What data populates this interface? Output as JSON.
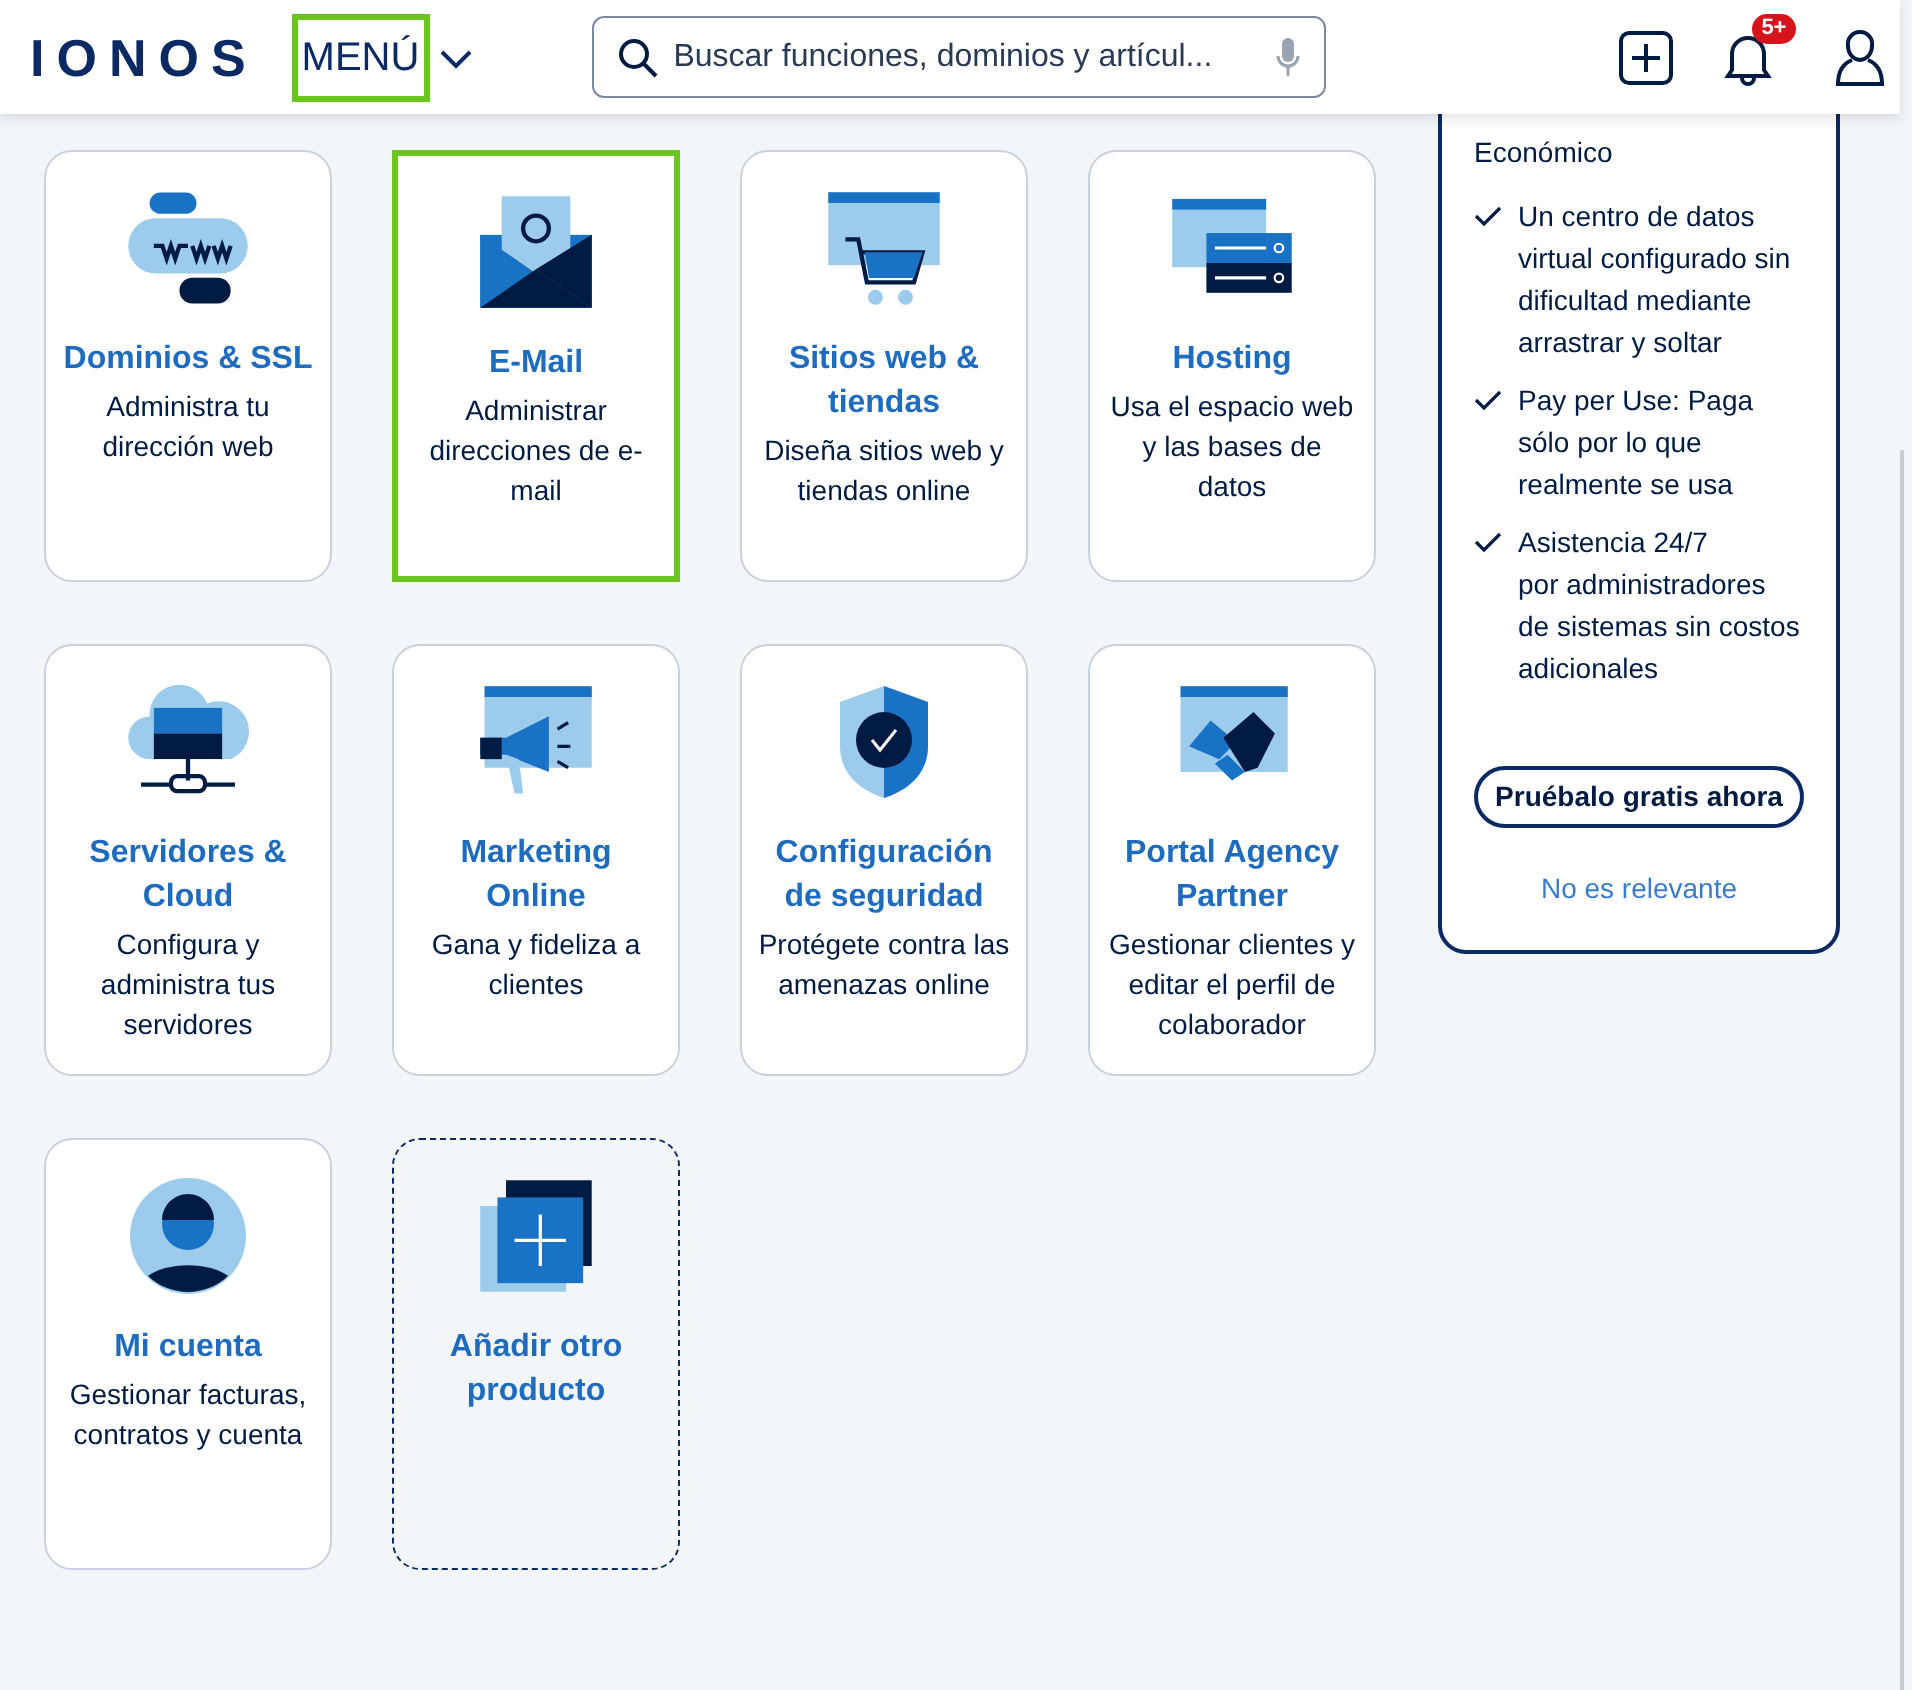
{
  "header": {
    "logo": "IONOS",
    "menu": {
      "label": "MENÚ",
      "highlighted": true
    },
    "search": {
      "placeholder": "Buscar funciones, dominios y artícul..."
    },
    "notifications": {
      "badge": "5+"
    }
  },
  "products": [
    {
      "kind": "product",
      "title": "Dominios & SSL",
      "description": "Administra tu dirección web",
      "highlighted": false
    },
    {
      "kind": "product",
      "title": "E-Mail",
      "description": "Administrar direcciones de e-mail",
      "highlighted": true
    },
    {
      "kind": "product",
      "title": "Sitios web & tiendas",
      "description": "Diseña sitios web y tiendas online",
      "highlighted": false
    },
    {
      "kind": "product",
      "title": "Hosting",
      "description": "Usa el espacio web y las bases de datos",
      "highlighted": false
    },
    {
      "kind": "product",
      "title": "Servidores & Cloud",
      "description": "Configura y administra tus servidores",
      "highlighted": false
    },
    {
      "kind": "product",
      "title": "Marketing Online",
      "description": "Gana y fideliza a clientes",
      "highlighted": false
    },
    {
      "kind": "product",
      "title": "Configuración de seguridad",
      "description": "Protégete contra las amenazas online",
      "highlighted": false
    },
    {
      "kind": "product",
      "title": "Portal Agency Partner",
      "description": "Gestionar clientes y editar el perfil de colaborador",
      "highlighted": false
    },
    {
      "kind": "product",
      "title": "Mi cuenta",
      "description": "Gestionar facturas, contratos y cuenta",
      "highlighted": false
    },
    {
      "kind": "add",
      "title": "Añadir otro producto",
      "highlighted": false
    }
  ],
  "promo": {
    "tagline": "Económico",
    "features": [
      "Un centro de datos virtual configurado sin\ndificultad mediante arrastrar y soltar",
      "Pay per Use: Paga sólo por lo que realmente se usa",
      "Asistencia 24/7\npor administradores de sistemas sin costos adicionales"
    ],
    "cta": "Pruébalo gratis ahora",
    "dismiss": "No es relevante"
  }
}
